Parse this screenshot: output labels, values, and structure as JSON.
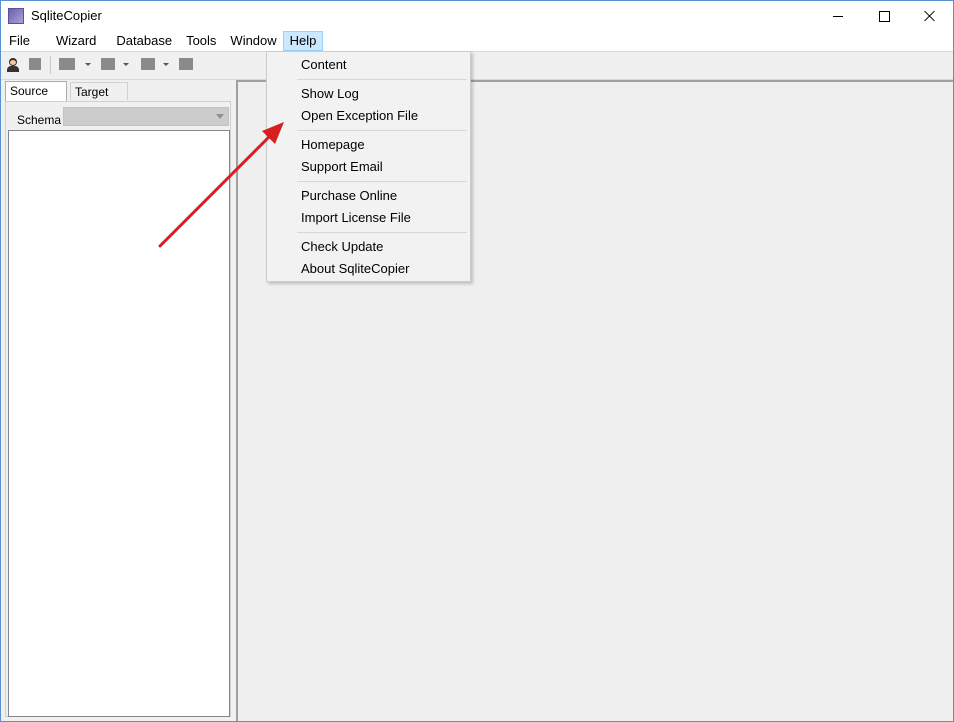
{
  "window": {
    "title": "SqliteCopier",
    "controls": {
      "minimize": "minimize-icon",
      "maximize": "maximize-icon",
      "close": "close-icon"
    }
  },
  "menubar": {
    "items": [
      {
        "label": "File"
      },
      {
        "label": "Wizard"
      },
      {
        "label": "Database"
      },
      {
        "label": "Tools"
      },
      {
        "label": "Window"
      },
      {
        "label": "Help",
        "active": true
      }
    ]
  },
  "toolbar": {
    "icons": [
      "person-icon",
      "toolbar-icon",
      "toolbar-icon",
      "dropdown-arrow-icon",
      "toolbar-icon",
      "dropdown-arrow-icon",
      "toolbar-icon",
      "dropdown-arrow-icon",
      "toolbar-icon"
    ]
  },
  "left_panel": {
    "tabs": [
      "Source DB",
      "Target DB"
    ],
    "selected_tab": "Source DB",
    "schema_label": "Schema",
    "schema_value": ""
  },
  "help_menu": {
    "groups": [
      [
        "Content"
      ],
      [
        "Show Log",
        "Open Exception File"
      ],
      [
        "Homepage",
        "Support Email"
      ],
      [
        "Purchase Online",
        "Import License File"
      ],
      [
        "Check Update",
        "About SqliteCopier"
      ]
    ]
  },
  "colors": {
    "menu_highlight": "#cce8ff",
    "annotation_arrow": "#d62020",
    "window_border": "#5a8fd0"
  }
}
